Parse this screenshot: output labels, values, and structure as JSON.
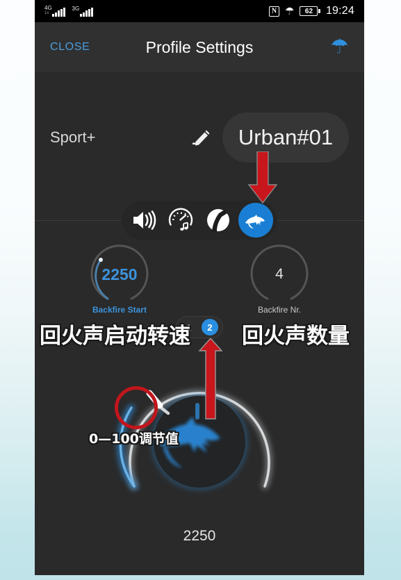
{
  "status_bar": {
    "network_primary": "4G",
    "network_primary_sub": "1x",
    "network_secondary": "3G",
    "nfc_icon": "nfc-icon",
    "bluetooth_icon": "bluetooth-icon",
    "battery_level": "62",
    "time": "19:24"
  },
  "header": {
    "close_label": "CLOSE",
    "title": "Profile Settings",
    "bluetooth_icon": "bluetooth-icon"
  },
  "profile": {
    "mode_label": "Sport+",
    "edit_icon": "pencil-edit-icon",
    "name": "Urban#01"
  },
  "tabs": [
    {
      "name": "volume-tab",
      "icon": "speaker-volume-icon",
      "selected": false
    },
    {
      "name": "rpm-sound-tab",
      "icon": "gauge-music-note-icon",
      "selected": false
    },
    {
      "name": "road-tab",
      "icon": "road-icon",
      "selected": false
    },
    {
      "name": "panther-tab",
      "icon": "panther-head-icon",
      "selected": true
    }
  ],
  "gauges": [
    {
      "value": "2250",
      "label": "Backfire Start",
      "active": true
    },
    {
      "value": "4",
      "label": "Backfire Nr.",
      "active": false
    }
  ],
  "page_indicator": {
    "pages": [
      "1",
      "2"
    ],
    "active_index": 1
  },
  "dial": {
    "bottom_value": "2250",
    "center_icon": "panther-head-icon",
    "handle_icon": "dial-handle-knob"
  },
  "annotations": {
    "label_left": "回火声启动转速",
    "label_right": "回火声数量",
    "label_knob": "0—100调节值",
    "arrow_to_tab": "red-down-arrow",
    "arrow_to_page": "red-up-arrow",
    "circle_knob": "red-circle-highlight"
  },
  "colors": {
    "accent_blue": "#2a8fe0",
    "link_blue": "#4a9fe0",
    "annotation_red": "#c0161c",
    "screen_bg": "#2a2a2a",
    "header_bg": "#303030"
  }
}
